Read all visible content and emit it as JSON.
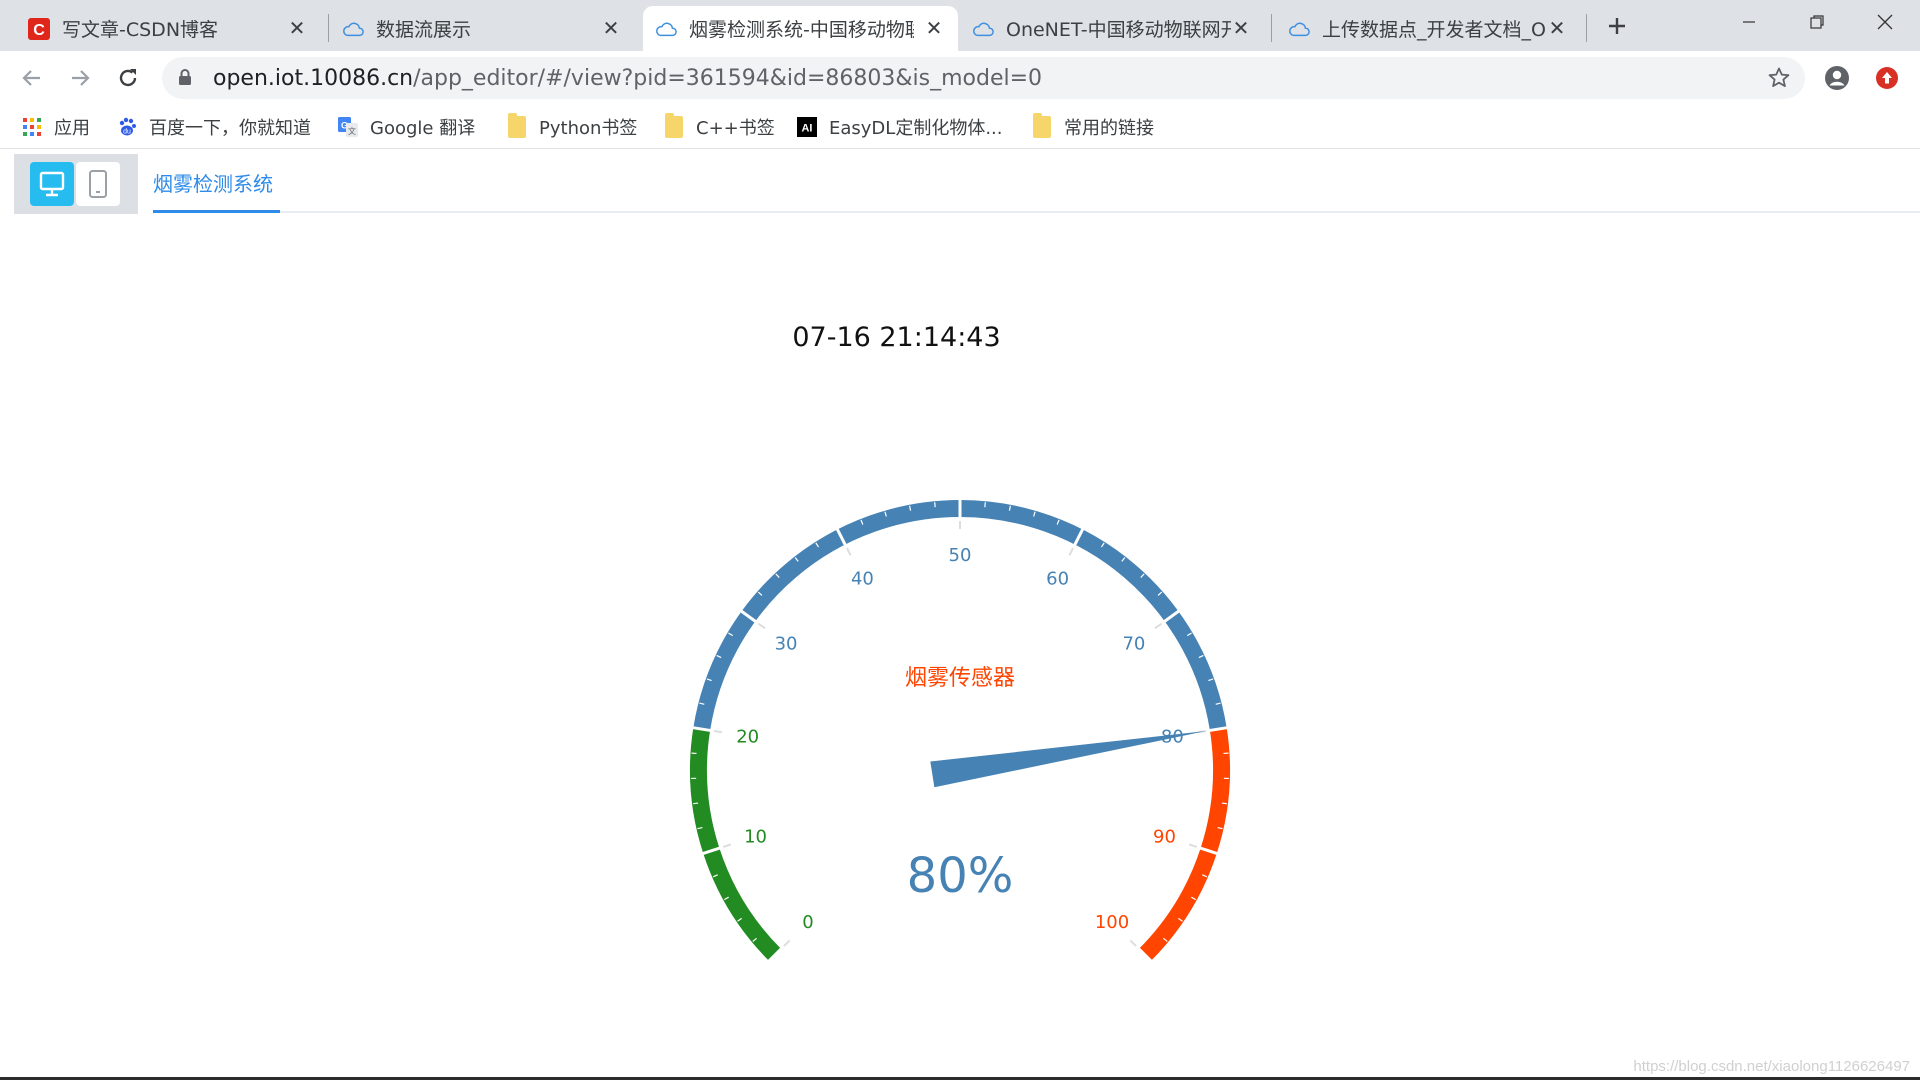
{
  "browser": {
    "tabs": [
      {
        "title": "写文章-CSDN博客",
        "icon": "csdn-logo-icon",
        "active": false
      },
      {
        "title": "数据流展示",
        "icon": "cloud-icon",
        "active": false
      },
      {
        "title": "烟雾检测系统-中国移动物联",
        "icon": "cloud-icon",
        "active": true
      },
      {
        "title": "OneNET-中国移动物联网开",
        "icon": "cloud-icon",
        "active": false
      },
      {
        "title": "上传数据点_开发者文档_On",
        "icon": "cloud-icon",
        "active": false
      }
    ],
    "new_tab_icon": "plus-icon",
    "url_host": "open.iot.10086.cn",
    "url_path": "/app_editor/#/view?pid=361594&id=86803&is_model=0",
    "bookmarks": [
      {
        "label": "应用",
        "icon": "apps-grid-icon"
      },
      {
        "label": "百度一下，你就知道",
        "icon": "baidu-paw-icon"
      },
      {
        "label": "Google 翻译",
        "icon": "google-translate-icon"
      },
      {
        "label": "Python书签",
        "icon": "folder-icon"
      },
      {
        "label": "C++书签",
        "icon": "folder-icon"
      },
      {
        "label": "EasyDL定制化物体...",
        "icon": "ai-logo-icon"
      },
      {
        "label": "常用的链接",
        "icon": "folder-icon"
      }
    ]
  },
  "app": {
    "page_tab": "烟雾检测系统",
    "timestamp": "07-16 21:14:43"
  },
  "gauge": {
    "title": "烟雾传感器",
    "value": 80,
    "value_display": "80%",
    "min": 0,
    "max": 100,
    "tick_labels": [
      "0",
      "10",
      "20",
      "30",
      "40",
      "50",
      "60",
      "70",
      "80",
      "90",
      "100"
    ],
    "bands": [
      {
        "from": 0,
        "to": 20,
        "color": "#228b22"
      },
      {
        "from": 20,
        "to": 80,
        "color": "#4682b4"
      },
      {
        "from": 80,
        "to": 100,
        "color": "#ff4500"
      }
    ],
    "title_color": "#ff4500",
    "pointer_color": "#4682b4"
  },
  "watermark": "https://blog.csdn.net/xiaolong1126626497"
}
